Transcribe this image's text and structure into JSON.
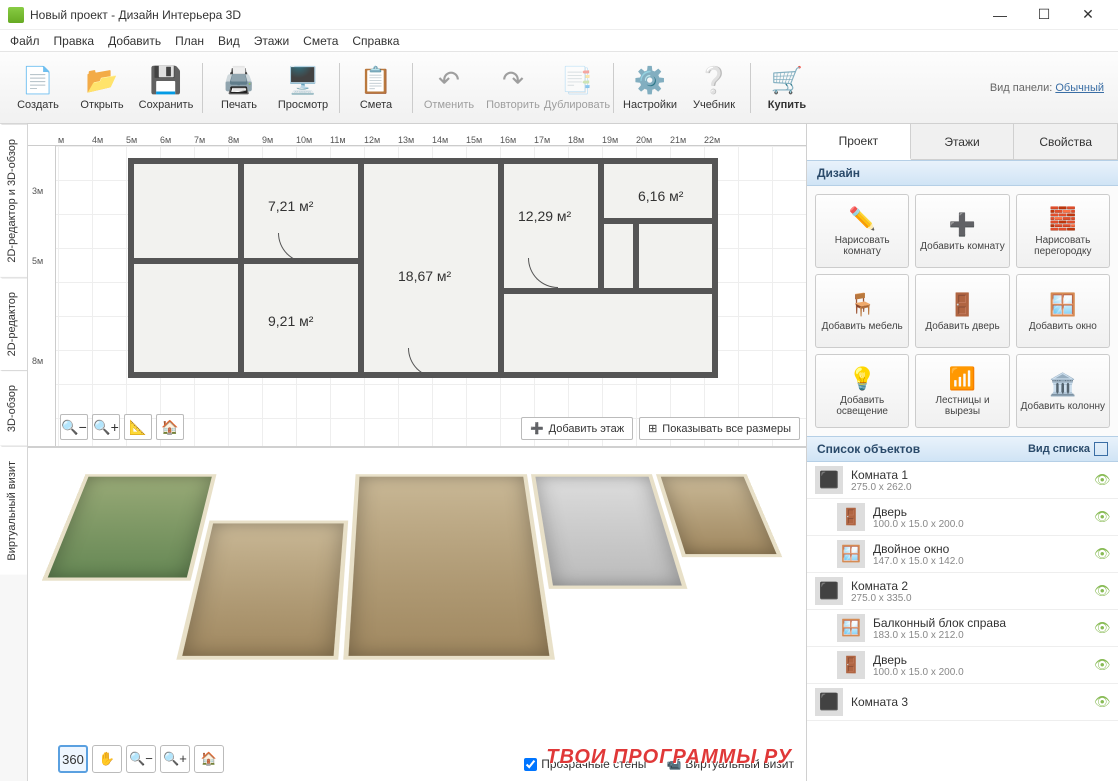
{
  "window": {
    "title": "Новый проект - Дизайн Интерьера 3D"
  },
  "menu": [
    "Файл",
    "Правка",
    "Добавить",
    "План",
    "Вид",
    "Этажи",
    "Смета",
    "Справка"
  ],
  "toolbar": {
    "create": "Создать",
    "open": "Открыть",
    "save": "Сохранить",
    "print": "Печать",
    "preview": "Просмотр",
    "estimate": "Смета",
    "undo": "Отменить",
    "redo": "Повторить",
    "duplicate": "Дублировать",
    "settings": "Настройки",
    "tutorial": "Учебник",
    "buy": "Купить",
    "panel_mode_label": "Вид панели:",
    "panel_mode_value": "Обычный"
  },
  "sidetabs": {
    "combo": "2D-редактор и 3D-обзор",
    "editor2d": "2D-редактор",
    "view3d": "3D-обзор",
    "virtual": "Виртуальный визит"
  },
  "ruler_h": [
    "м",
    "4м",
    "5м",
    "6м",
    "7м",
    "8м",
    "9м",
    "10м",
    "11м",
    "12м",
    "13м",
    "14м",
    "15м",
    "16м",
    "17м",
    "18м",
    "19м",
    "20м",
    "21м",
    "22м"
  ],
  "ruler_v": [
    "3м",
    "5м",
    "8м"
  ],
  "rooms": {
    "r1": "7,21 м²",
    "r2": "18,67 м²",
    "r3": "12,29 м²",
    "r4": "6,16 м²",
    "r5": "9,21 м²"
  },
  "plan_buttons": {
    "add_floor": "Добавить этаж",
    "show_sizes": "Показывать все размеры"
  },
  "view3d_controls": {
    "transparent": "Прозрачные стены",
    "camera": "Виртуальный визит"
  },
  "right_tabs": {
    "project": "Проект",
    "floors": "Этажи",
    "props": "Свойства"
  },
  "design_header": "Дизайн",
  "design": [
    {
      "k": "draw_room",
      "l": "Нарисовать комнату",
      "ic": "✏️"
    },
    {
      "k": "add_room",
      "l": "Добавить комнату",
      "ic": "➕"
    },
    {
      "k": "draw_wall",
      "l": "Нарисовать перегородку",
      "ic": "🧱"
    },
    {
      "k": "add_furn",
      "l": "Добавить мебель",
      "ic": "🪑"
    },
    {
      "k": "add_door",
      "l": "Добавить дверь",
      "ic": "🚪"
    },
    {
      "k": "add_window",
      "l": "Добавить окно",
      "ic": "🪟"
    },
    {
      "k": "add_light",
      "l": "Добавить освещение",
      "ic": "💡"
    },
    {
      "k": "stairs",
      "l": "Лестницы и вырезы",
      "ic": "📶"
    },
    {
      "k": "add_column",
      "l": "Добавить колонну",
      "ic": "🏛️"
    }
  ],
  "objects_header": "Список объектов",
  "list_mode": "Вид списка",
  "objects": [
    {
      "name": "Комната 1",
      "dim": "275.0 x 262.0",
      "ic": "⬛",
      "child": false
    },
    {
      "name": "Дверь",
      "dim": "100.0 x 15.0 x 200.0",
      "ic": "🚪",
      "child": true
    },
    {
      "name": "Двойное окно",
      "dim": "147.0 x 15.0 x 142.0",
      "ic": "🪟",
      "child": true
    },
    {
      "name": "Комната 2",
      "dim": "275.0 x 335.0",
      "ic": "⬛",
      "child": false
    },
    {
      "name": "Балконный блок справа",
      "dim": "183.0 x 15.0 x 212.0",
      "ic": "🪟",
      "child": true
    },
    {
      "name": "Дверь",
      "dim": "100.0 x 15.0 x 200.0",
      "ic": "🚪",
      "child": true
    },
    {
      "name": "Комната 3",
      "dim": "",
      "ic": "⬛",
      "child": false
    }
  ],
  "watermark": "ТВОИ ПРОГРАММЫ РУ"
}
